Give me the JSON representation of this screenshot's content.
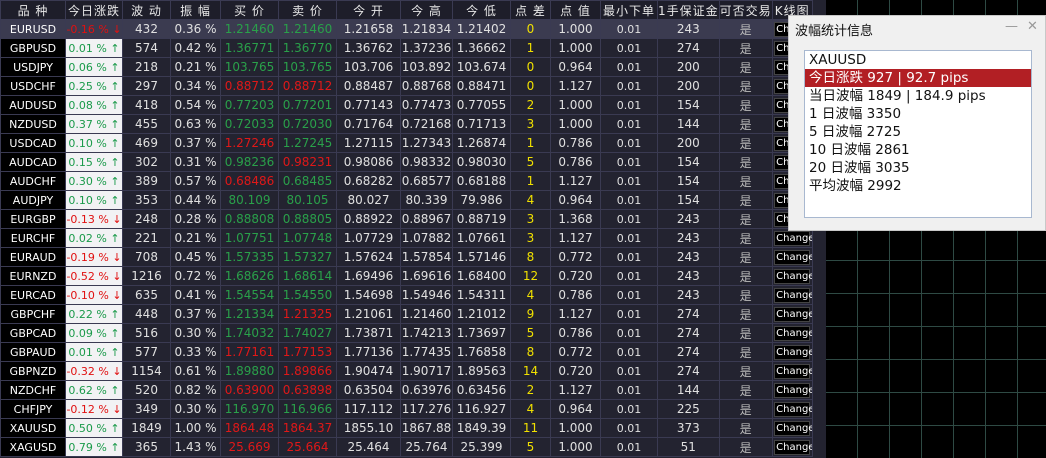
{
  "headers": [
    "品 种",
    "今日涨跌",
    "波 动",
    "振 幅",
    "买 价",
    "卖 价",
    "今 开",
    "今 高",
    "今 低",
    "点 差",
    "点 值",
    "最小下单",
    "1手保证金",
    "可否交易",
    "K线图"
  ],
  "rows": [
    [
      "EURUSD",
      "-0.16 % ↓",
      "432",
      "0.36 %",
      "1.21460",
      "1.21460",
      "1.21658",
      "1.21834",
      "1.21402",
      "0",
      "1.000",
      "0.01",
      "243",
      "是",
      "Change",
      "dn",
      "g",
      "g"
    ],
    [
      "GBPUSD",
      "0.01 % ↑",
      "574",
      "0.42 %",
      "1.36771",
      "1.36770",
      "1.36762",
      "1.37236",
      "1.36662",
      "1",
      "1.000",
      "0.01",
      "274",
      "是",
      "Change",
      "up",
      "g",
      "g"
    ],
    [
      "USDJPY",
      "0.06 % ↑",
      "218",
      "0.21 %",
      "103.765",
      "103.765",
      "103.706",
      "103.892",
      "103.674",
      "0",
      "0.964",
      "0.01",
      "200",
      "是",
      "Change",
      "up",
      "g",
      "g"
    ],
    [
      "USDCHF",
      "0.25 % ↑",
      "297",
      "0.34 %",
      "0.88712",
      "0.88712",
      "0.88487",
      "0.88768",
      "0.88471",
      "0",
      "1.127",
      "0.01",
      "200",
      "是",
      "Change",
      "up",
      "r",
      "r"
    ],
    [
      "AUDUSD",
      "0.08 % ↑",
      "418",
      "0.54 %",
      "0.77203",
      "0.77201",
      "0.77143",
      "0.77473",
      "0.77055",
      "2",
      "1.000",
      "0.01",
      "154",
      "是",
      "Change",
      "up",
      "g",
      "g"
    ],
    [
      "NZDUSD",
      "0.37 % ↑",
      "455",
      "0.63 %",
      "0.72033",
      "0.72030",
      "0.71764",
      "0.72168",
      "0.71713",
      "3",
      "1.000",
      "0.01",
      "144",
      "是",
      "Change",
      "up",
      "g",
      "g"
    ],
    [
      "USDCAD",
      "0.10 % ↑",
      "469",
      "0.37 %",
      "1.27246",
      "1.27245",
      "1.27115",
      "1.27343",
      "1.26874",
      "1",
      "0.786",
      "0.01",
      "200",
      "是",
      "Change",
      "up",
      "r",
      "g"
    ],
    [
      "AUDCAD",
      "0.15 % ↑",
      "302",
      "0.31 %",
      "0.98236",
      "0.98231",
      "0.98086",
      "0.98332",
      "0.98030",
      "5",
      "0.786",
      "0.01",
      "154",
      "是",
      "Change",
      "up",
      "g",
      "r"
    ],
    [
      "AUDCHF",
      "0.30 % ↑",
      "389",
      "0.57 %",
      "0.68486",
      "0.68485",
      "0.68282",
      "0.68577",
      "0.68188",
      "1",
      "1.127",
      "0.01",
      "154",
      "是",
      "Change",
      "up",
      "r",
      "g"
    ],
    [
      "AUDJPY",
      "0.10 % ↑",
      "353",
      "0.44 %",
      "80.109",
      "80.105",
      "80.027",
      "80.339",
      "79.986",
      "4",
      "0.964",
      "0.01",
      "154",
      "是",
      "Change",
      "up",
      "g",
      "g"
    ],
    [
      "EURGBP",
      "-0.13 % ↓",
      "248",
      "0.28 %",
      "0.88808",
      "0.88805",
      "0.88922",
      "0.88967",
      "0.88719",
      "3",
      "1.368",
      "0.01",
      "243",
      "是",
      "Change",
      "dn",
      "g",
      "g"
    ],
    [
      "EURCHF",
      "0.02 % ↑",
      "221",
      "0.21 %",
      "1.07751",
      "1.07748",
      "1.07729",
      "1.07882",
      "1.07661",
      "3",
      "1.127",
      "0.01",
      "243",
      "是",
      "Change",
      "up",
      "g",
      "g"
    ],
    [
      "EURAUD",
      "-0.19 % ↓",
      "708",
      "0.45 %",
      "1.57335",
      "1.57327",
      "1.57624",
      "1.57854",
      "1.57146",
      "8",
      "0.772",
      "0.01",
      "243",
      "是",
      "Change",
      "dn",
      "g",
      "g"
    ],
    [
      "EURNZD",
      "-0.52 % ↓",
      "1216",
      "0.72 %",
      "1.68626",
      "1.68614",
      "1.69496",
      "1.69616",
      "1.68400",
      "12",
      "0.720",
      "0.01",
      "243",
      "是",
      "Change",
      "dn",
      "g",
      "g"
    ],
    [
      "EURCAD",
      "-0.10 % ↓",
      "635",
      "0.41 %",
      "1.54554",
      "1.54550",
      "1.54698",
      "1.54946",
      "1.54311",
      "4",
      "0.786",
      "0.01",
      "243",
      "是",
      "Change",
      "dn",
      "g",
      "g"
    ],
    [
      "GBPCHF",
      "0.22 % ↑",
      "448",
      "0.37 %",
      "1.21334",
      "1.21325",
      "1.21061",
      "1.21460",
      "1.21012",
      "9",
      "1.127",
      "0.01",
      "274",
      "是",
      "Change",
      "up",
      "g",
      "r"
    ],
    [
      "GBPCAD",
      "0.09 % ↑",
      "516",
      "0.30 %",
      "1.74032",
      "1.74027",
      "1.73871",
      "1.74213",
      "1.73697",
      "5",
      "0.786",
      "0.01",
      "274",
      "是",
      "Change",
      "up",
      "g",
      "g"
    ],
    [
      "GBPAUD",
      "0.01 % ↑",
      "577",
      "0.33 %",
      "1.77161",
      "1.77153",
      "1.77136",
      "1.77435",
      "1.76858",
      "8",
      "0.772",
      "0.01",
      "274",
      "是",
      "Change",
      "up",
      "r",
      "r"
    ],
    [
      "GBPNZD",
      "-0.32 % ↓",
      "1154",
      "0.61 %",
      "1.89880",
      "1.89866",
      "1.90474",
      "1.90717",
      "1.89563",
      "14",
      "0.720",
      "0.01",
      "274",
      "是",
      "Change",
      "dn",
      "g",
      "r"
    ],
    [
      "NZDCHF",
      "0.62 % ↑",
      "520",
      "0.82 %",
      "0.63900",
      "0.63898",
      "0.63504",
      "0.63976",
      "0.63456",
      "2",
      "1.127",
      "0.01",
      "144",
      "是",
      "Change",
      "up",
      "r",
      "r"
    ],
    [
      "CHFJPY",
      "-0.12 % ↓",
      "349",
      "0.30 %",
      "116.970",
      "116.966",
      "117.112",
      "117.276",
      "116.927",
      "4",
      "0.964",
      "0.01",
      "225",
      "是",
      "Change",
      "dn",
      "g",
      "g"
    ],
    [
      "XAUUSD",
      "0.50 % ↑",
      "1849",
      "1.00 %",
      "1864.48",
      "1864.37",
      "1855.10",
      "1867.88",
      "1849.39",
      "11",
      "1.000",
      "0.01",
      "373",
      "是",
      "Change",
      "up",
      "r",
      "r"
    ],
    [
      "XAGUSD",
      "0.79 % ↑",
      "365",
      "1.43 %",
      "25.669",
      "25.664",
      "25.464",
      "25.764",
      "25.399",
      "5",
      "1.000",
      "0.01",
      "51",
      "是",
      "Change",
      "up",
      "r",
      "r"
    ]
  ],
  "popup": {
    "title": "波幅统计信息",
    "minimize": "—",
    "close": "✕",
    "items": [
      "XAUUSD",
      "今日涨跌 927 | 92.7 pips",
      "当日波幅 1849 | 184.9 pips",
      "1 日波幅 3350",
      "5 日波幅 2725",
      "10 日波幅 2861",
      "20 日波幅 3035",
      "平均波幅 2992"
    ],
    "selected_index": 1
  },
  "colors": {
    "up": "#1a9a4a",
    "down": "#e01010",
    "spread": "#f0e000",
    "selected": "#b21f24"
  }
}
